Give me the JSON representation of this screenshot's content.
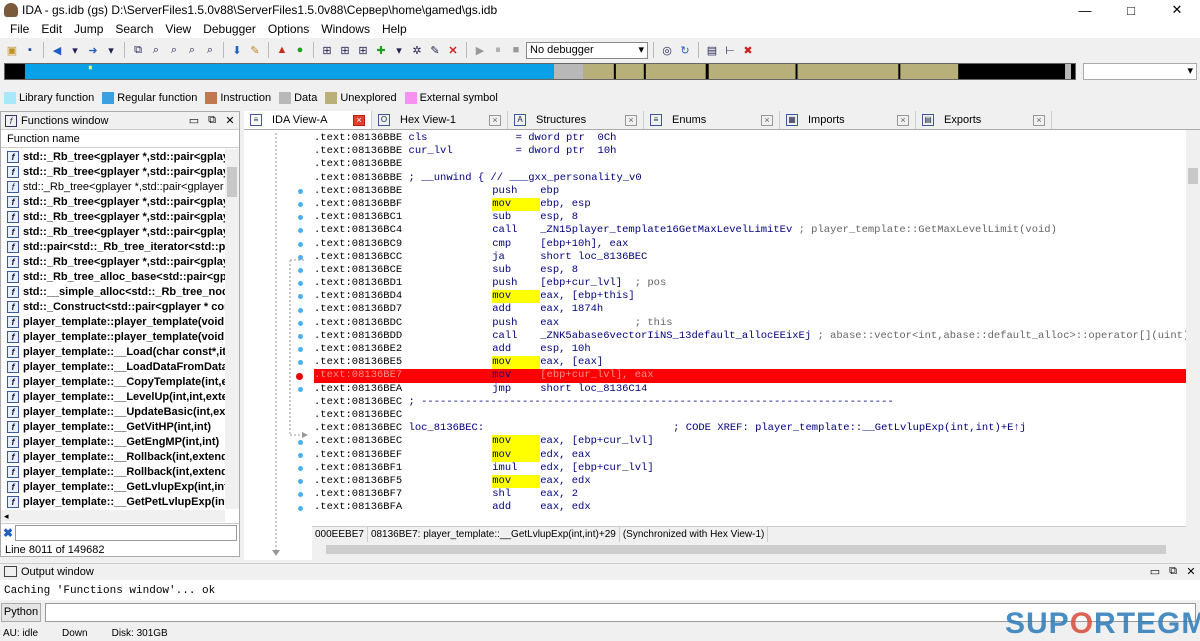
{
  "window": {
    "title": "IDA - gs.idb (gs) D:\\ServerFiles1.5.0v88\\ServerFiles1.5.0v88\\Сервер\\home\\gamed\\gs.idb",
    "min": "—",
    "max": "□",
    "close": "✕"
  },
  "menu": [
    "File",
    "Edit",
    "Jump",
    "Search",
    "View",
    "Debugger",
    "Options",
    "Windows",
    "Help"
  ],
  "toolbar": {
    "debugger_select": "No debugger",
    "icons": [
      "save-db-icon",
      "back-icon",
      "forward-icon",
      "new-func-icon",
      "jump-icon",
      "search-icon",
      "play-icon",
      "pause-icon",
      "stop-icon",
      "close-red-icon"
    ]
  },
  "legend": [
    {
      "label": "Library function",
      "color": "#a8e8f8"
    },
    {
      "label": "Regular function",
      "color": "#3aa0e0"
    },
    {
      "label": "Instruction",
      "color": "#c07850"
    },
    {
      "label": "Data",
      "color": "#b8b8b8"
    },
    {
      "label": "Unexplored",
      "color": "#b8b078"
    },
    {
      "label": "External symbol",
      "color": "#f890f0"
    }
  ],
  "functions": {
    "title": "Functions window",
    "column": "Function name",
    "items": [
      {
        "name": "std::_Rb_tree<gplayer *,std::pair<gplay",
        "bold": true
      },
      {
        "name": "std::_Rb_tree<gplayer *,std::pair<gplay",
        "bold": true
      },
      {
        "name": "std::_Rb_tree<gplayer *,std::pair<gplayer * c",
        "bold": false
      },
      {
        "name": "std::_Rb_tree<gplayer *,std::pair<gplay",
        "bold": true
      },
      {
        "name": "std::_Rb_tree<gplayer *,std::pair<gplay",
        "bold": true
      },
      {
        "name": "std::_Rb_tree<gplayer *,std::pair<gplay",
        "bold": true
      },
      {
        "name": "std::pair<std::_Rb_tree_iterator<std::pa",
        "bold": true
      },
      {
        "name": "std::_Rb_tree<gplayer *,std::pair<gplay",
        "bold": true
      },
      {
        "name": "std::_Rb_tree_alloc_base<std::pair<gpl",
        "bold": true
      },
      {
        "name": "std::__simple_alloc<std::_Rb_tree_node",
        "bold": true
      },
      {
        "name": "std::_Construct<std::pair<gplayer * con",
        "bold": true
      },
      {
        "name": "player_template::player_template(void",
        "bold": true
      },
      {
        "name": "player_template::player_template(void",
        "bold": true
      },
      {
        "name": "player_template::__Load(char const*,it",
        "bold": true
      },
      {
        "name": "player_template::__LoadDataFromData",
        "bold": true
      },
      {
        "name": "player_template::__CopyTemplate(int,e",
        "bold": true
      },
      {
        "name": "player_template::__LevelUp(int,int,exte",
        "bold": true
      },
      {
        "name": "player_template::__UpdateBasic(int,ext",
        "bold": true
      },
      {
        "name": "player_template::__GetVitHP(int,int)",
        "bold": true
      },
      {
        "name": "player_template::__GetEngMP(int,int)",
        "bold": true
      },
      {
        "name": "player_template::__Rollback(int,extend",
        "bold": true
      },
      {
        "name": "player_template::__Rollback(int,extend",
        "bold": true
      },
      {
        "name": "player_template::__GetLvlupExp(int,int",
        "bold": true
      },
      {
        "name": "player_template::__GetPetLvlupExp(int",
        "bold": true
      }
    ],
    "line_info": "Line 8011 of 149682"
  },
  "tabs": [
    {
      "label": "IDA View-A",
      "icon": "≡",
      "active": true
    },
    {
      "label": "Hex View-1",
      "icon": "O",
      "active": false
    },
    {
      "label": "Structures",
      "icon": "A",
      "active": false
    },
    {
      "label": "Enums",
      "icon": "≡",
      "active": false
    },
    {
      "label": "Imports",
      "icon": "▦",
      "active": false
    },
    {
      "label": "Exports",
      "icon": "▤",
      "active": false
    }
  ],
  "disasm": [
    {
      "addr": ".text:08136BBE",
      "text": " cls              = dword ptr  0Ch"
    },
    {
      "addr": ".text:08136BBE",
      "text": " cur_lvl          = dword ptr  10h"
    },
    {
      "addr": ".text:08136BBE",
      "text": ""
    },
    {
      "addr": ".text:08136BBE",
      "text": " ; __unwind { // ___gxx_personality_v0"
    },
    {
      "addr": ".text:08136BBE",
      "mn": "push",
      "op": "ebp"
    },
    {
      "addr": ".text:08136BBF",
      "mn": "mov",
      "op": "ebp, esp",
      "hl": true
    },
    {
      "addr": ".text:08136BC1",
      "mn": "sub",
      "op": "esp, 8"
    },
    {
      "addr": ".text:08136BC4",
      "mn": "call",
      "op": "_ZN15player_template16GetMaxLevelLimitEv",
      "cm": " ; player_template::GetMaxLevelLimit(void)"
    },
    {
      "addr": ".text:08136BC9",
      "mn": "cmp",
      "op": "[ebp+10h], eax"
    },
    {
      "addr": ".text:08136BCC",
      "mn": "ja",
      "op": "short loc_8136BEC"
    },
    {
      "addr": ".text:08136BCE",
      "mn": "sub",
      "op": "esp, 8"
    },
    {
      "addr": ".text:08136BD1",
      "mn": "push",
      "op": "[ebp+cur_lvl]",
      "cm": "  ; pos"
    },
    {
      "addr": ".text:08136BD4",
      "mn": "mov",
      "op": "eax, [ebp+this]",
      "hl": true
    },
    {
      "addr": ".text:08136BD7",
      "mn": "add",
      "op": "eax, 1874h"
    },
    {
      "addr": ".text:08136BDC",
      "mn": "push",
      "op": "eax",
      "cm": "            ; this"
    },
    {
      "addr": ".text:08136BDD",
      "mn": "call",
      "op": "_ZNK5abase6vectorIiNS_13default_allocEEixEj",
      "cm": " ; abase::vector<int,abase::default_alloc>::operator[](uint)"
    },
    {
      "addr": ".text:08136BE2",
      "mn": "add",
      "op": "esp, 10h"
    },
    {
      "addr": ".text:08136BE5",
      "mn": "mov",
      "op": "eax, [eax]",
      "hl": true
    },
    {
      "addr": ".text:08136BE7",
      "mn": "mov",
      "op": "[ebp+cur_lvl], eax",
      "bp": true
    },
    {
      "addr": ".text:08136BEA",
      "mn": "jmp",
      "op": "short loc_8136C14"
    },
    {
      "addr": ".text:08136BEC",
      "text": " ; ---------------------------------------------------------------------------"
    },
    {
      "addr": ".text:08136BEC",
      "text": ""
    },
    {
      "addr": ".text:08136BEC",
      "text": " loc_8136BEC:                              ; CODE XREF: player_template::__GetLvlupExp(int,int)+E↑j"
    },
    {
      "addr": ".text:08136BEC",
      "mn": "mov",
      "op": "eax, [ebp+cur_lvl]",
      "hl": true
    },
    {
      "addr": ".text:08136BEF",
      "mn": "mov",
      "op": "edx, eax",
      "hl": true
    },
    {
      "addr": ".text:08136BF1",
      "mn": "imul",
      "op": "edx, [ebp+cur_lvl]"
    },
    {
      "addr": ".text:08136BF5",
      "mn": "mov",
      "op": "eax, edx",
      "hl": true
    },
    {
      "addr": ".text:08136BF7",
      "mn": "shl",
      "op": "eax, 2"
    },
    {
      "addr": ".text:08136BFA",
      "mn": "add",
      "op": "eax, edx"
    }
  ],
  "disasm_status": [
    "000EEBE7",
    "08136BE7: player_template::__GetLvlupExp(int,int)+29",
    "(Synchronized with Hex View-1)"
  ],
  "output": {
    "title": "Output window",
    "text": "Caching 'Functions window'... ok",
    "python": "Python"
  },
  "status": {
    "au": "AU:  idle",
    "dir": "Down",
    "disk": "Disk: 301GB"
  },
  "watermark": {
    "a": "SUP",
    "o": "O",
    "b": "RTEGM"
  }
}
